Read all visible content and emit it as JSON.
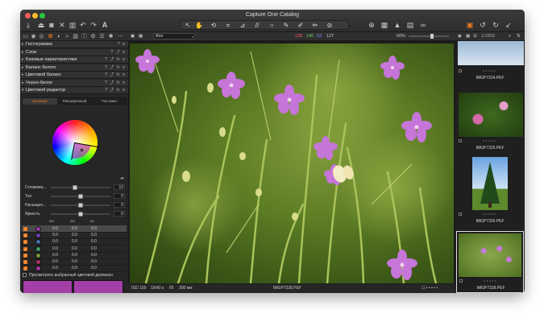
{
  "window": {
    "title": "Capture One Catalog"
  },
  "toolbar": {
    "left_icons": [
      "import-icon",
      "tether-icon",
      "camera-icon",
      "delete-icon",
      "trash-icon",
      "undo-icon",
      "redo-icon",
      "text-icon"
    ],
    "cursor_tools": [
      "pan-icon",
      "select-icon",
      "rotate-icon",
      "crop-icon",
      "straighten-icon",
      "keystone-icon",
      "spot-icon",
      "brush-icon",
      "erase-icon",
      "gradient-icon",
      "picker-icon"
    ],
    "right_icons": [
      "copy-icon",
      "focus-icon",
      "warning-icon",
      "exposure-warning-icon",
      "proof-icon",
      "stack-icon",
      "rotate-left-icon",
      "rotate-right-icon",
      "apply-icon"
    ]
  },
  "tool_tabs": [
    "library-icon",
    "capture-icon",
    "lens-icon",
    "color-icon",
    "exposure-icon",
    "details-icon",
    "adjustments-icon",
    "metadata-icon",
    "output-icon",
    "batch-icon",
    "settings-icon",
    "help-icon"
  ],
  "tools": [
    {
      "label": "Гистограмма",
      "controls": "? ≡"
    },
    {
      "label": "Слои",
      "controls": "? ⤴ ≡"
    },
    {
      "label": "Базовые характеристики",
      "controls": "? ⤴ ↻ ≡"
    },
    {
      "label": "Баланс белого",
      "controls": "? ⤴ ↻ ≡"
    },
    {
      "label": "Цветовой баланс",
      "controls": "? ⤴ ↻ ≡"
    },
    {
      "label": "Черно-белое",
      "controls": "? ⤴ ↻ ≡"
    },
    {
      "label": "Цветовой редактор",
      "controls": "? ⤴ ↻ ≡"
    }
  ],
  "color_editor": {
    "tabs": [
      "Базовый",
      "Расширенный",
      "Тон кожи"
    ],
    "active_tab": 0,
    "sliders": [
      {
        "label": "Сглажива...",
        "value": "12",
        "position": 0.4
      },
      {
        "label": "Тон",
        "value": "0",
        "position": 0.5
      },
      {
        "label": "Насыщен...",
        "value": "0",
        "position": 0.5
      },
      {
        "label": "Яркость",
        "value": "0",
        "position": 0.5
      }
    ],
    "range_headers": [
      "ΔH",
      "ΔS",
      "ΔL"
    ],
    "ranges": [
      {
        "color": "#9a3aa5",
        "dh": "0.0",
        "ds": "0.0",
        "dl": "0.0",
        "selected": true
      },
      {
        "color": "#6f3fb0",
        "dh": "0.0",
        "ds": "0.0",
        "dl": "0.0",
        "selected": false
      },
      {
        "color": "#4a6fb0",
        "dh": "0.0",
        "ds": "0.0",
        "dl": "0.0",
        "selected": false
      },
      {
        "color": "#3f9a6a",
        "dh": "0.0",
        "ds": "0.0",
        "dl": "0.0",
        "selected": false
      },
      {
        "color": "#7a9a3a",
        "dh": "0.0",
        "ds": "0.0",
        "dl": "0.0",
        "selected": false
      },
      {
        "color": "#a8325a",
        "dh": "0.0",
        "ds": "0.0",
        "dl": "0.0",
        "selected": false
      },
      {
        "color": "#a53a9a",
        "dh": "0.0",
        "ds": "0.0",
        "dl": "0.0",
        "selected": false
      }
    ],
    "view_selected_label": "Просмотреть выбранный цветовой диапазон",
    "preview_color": "#a43fa8"
  },
  "viewer_bar": {
    "select_value": "Фон",
    "readout": {
      "r": "128",
      "g": "140",
      "b": "53",
      "l": "127"
    },
    "zoom": "50%"
  },
  "viewer_status": {
    "iso": "ISO 100",
    "shutter": "1/640 s",
    "aperture": "f/5",
    "focal": "300 мм",
    "filename": "IMGP7328.PEF"
  },
  "browser": {
    "counter": "1/1559",
    "thumbs": [
      {
        "name": "IMGP7324.PEF",
        "selected": false
      },
      {
        "name": "IMGP7325.PEF",
        "selected": false
      },
      {
        "name": "IMGP7326.PEF",
        "selected": false
      },
      {
        "name": "IMGP7328.PEF",
        "selected": true
      }
    ]
  }
}
